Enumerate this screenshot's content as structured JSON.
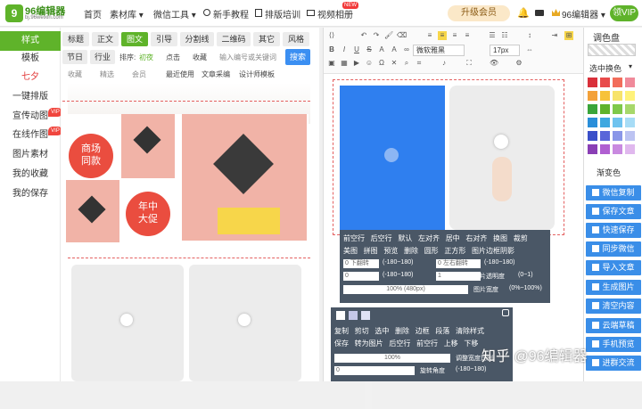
{
  "topnav": {
    "logo_text": "96编辑器",
    "logo_sub": "bj.96weixin.com",
    "items": [
      "首页",
      "素材库 ▾",
      "微信工具 ▾",
      "新手教程",
      "排版培训",
      "视频相册"
    ],
    "new_badge": "NEW",
    "upgrade": "升级会员",
    "user": "96编辑器 ▾",
    "vip": "领VIP"
  },
  "sidebar": {
    "items": [
      "样式",
      "模板",
      "七夕",
      "一键排版",
      "宣传动图",
      "在线作图",
      "图片素材",
      "我的收藏",
      "我的保存"
    ],
    "vip_label": "VIP"
  },
  "material": {
    "tags_row1": [
      "标题",
      "正文",
      "图文",
      "引导",
      "分割线",
      "二维码",
      "其它",
      "风格"
    ],
    "tags_row2": [
      "节日",
      "行业"
    ],
    "sort_label": "排序:",
    "sort_options": [
      "初夜",
      "点击",
      "收藏"
    ],
    "search_placeholder": "输入编号或关键词",
    "search_btn": "搜索",
    "filters": [
      "收藏",
      "精选",
      "会员"
    ],
    "links": [
      "最近使用",
      "文章采编",
      "设计师模板"
    ],
    "card_labels": {
      "circle1": "商场同款",
      "circle2": "年中大促"
    }
  },
  "editor": {
    "font_select": "微软雅黑",
    "size_select": "17px",
    "popup1": {
      "row1": [
        "前空行",
        "后空行",
        "默认",
        "左对齐",
        "居中",
        "右对齐",
        "换图",
        "裁剪"
      ],
      "row2": [
        "美图",
        "拼图",
        "预览",
        "删除",
        "圆形",
        "正方形",
        "图片边框阴影"
      ],
      "row3": [
        "0",
        "下翻转",
        "(-180~180)",
        "0",
        "左右翻转",
        "(-180~180)"
      ],
      "row4": [
        "0",
        "旋转角度",
        "(-180~180)",
        "1",
        "图片透明度",
        "(0~1)"
      ],
      "row5": [
        "100% (480px)",
        "图片宽度",
        "(0%~100%)"
      ]
    },
    "popup2": {
      "row1": [
        "复制",
        "剪切",
        "选中",
        "删除",
        "边框",
        "段落",
        "清除样式"
      ],
      "row2": [
        "保存",
        "转为图片",
        "后空行",
        "前空行",
        "上移",
        "下移"
      ],
      "row3": [
        "100%",
        "调整宽度比例"
      ],
      "row4": [
        "0",
        "旋转角度",
        "(-180~180)"
      ]
    }
  },
  "right": {
    "palette_title": "调色盘",
    "select_label": "选中换色",
    "gradient": "渐变色",
    "buttons": [
      "微信复制",
      "保存文章",
      "快速保存",
      "同步微信",
      "导入文章",
      "生成图片",
      "清空内容",
      "云端草稿",
      "手机预览",
      "进群交流"
    ]
  },
  "watermark": "知乎 @96编辑器",
  "colors": {
    "green": "#5fb32a",
    "blue": "#3a8ee8",
    "popup": "#4a5766"
  }
}
